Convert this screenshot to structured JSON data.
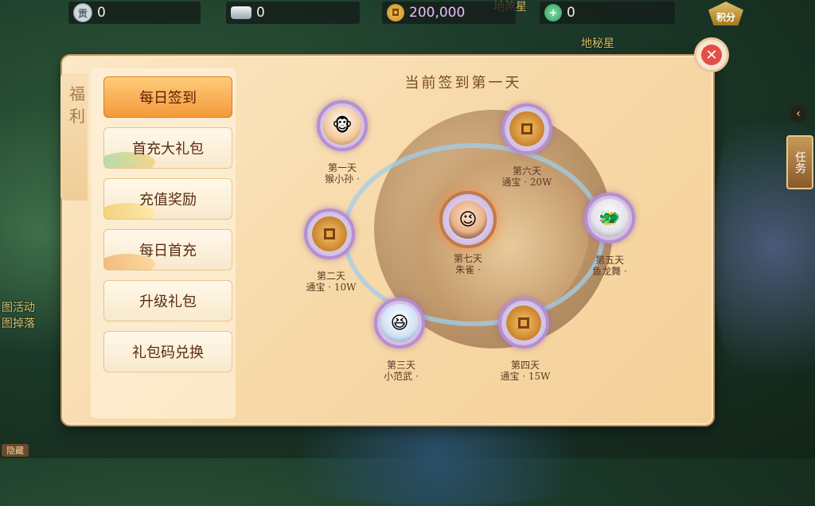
{
  "topbar": {
    "tickets": "0",
    "silver": "0",
    "coins": "200,000",
    "jade": "0",
    "points_label": "积分"
  },
  "background_texts": [
    "地煞星",
    "地秘星",
    "图活动",
    "图掉落"
  ],
  "panel": {
    "tab_title": "福利",
    "menu": [
      {
        "label": "每日签到",
        "active": true
      },
      {
        "label": "首充大礼包",
        "active": false
      },
      {
        "label": "充值奖励",
        "active": false
      },
      {
        "label": "每日首充",
        "active": false
      },
      {
        "label": "升级礼包",
        "active": false
      },
      {
        "label": "礼包码兑换",
        "active": false
      }
    ],
    "signin_title": "当前签到第一天",
    "days": [
      {
        "day": "第一天",
        "reward": "猴小孙 ·"
      },
      {
        "day": "第二天",
        "reward": "通宝 · 10W"
      },
      {
        "day": "第三天",
        "reward": "小范武 ·"
      },
      {
        "day": "第四天",
        "reward": "通宝 · 15W"
      },
      {
        "day": "第五天",
        "reward": "鱼龙舞 ·"
      },
      {
        "day": "第六天",
        "reward": "通宝 · 20W"
      },
      {
        "day": "第七天",
        "reward": "朱雀 ·"
      }
    ]
  },
  "side": {
    "task_label": "任务",
    "arrow": "‹"
  },
  "bottom_chip": "隐藏"
}
